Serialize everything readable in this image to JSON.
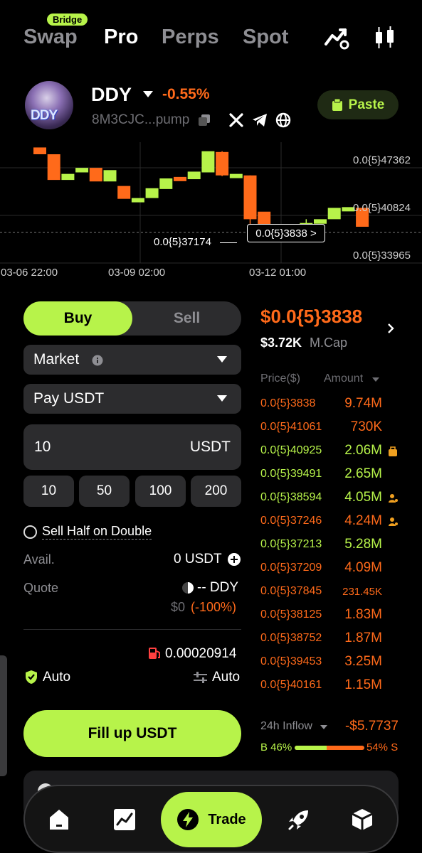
{
  "top_tabs": {
    "bridge_badge": "Bridge",
    "swap": "Swap",
    "pro": "Pro",
    "perps": "Perps",
    "spot": "Spot",
    "icons": [
      "chart-trend-icon",
      "candlestick-icon"
    ]
  },
  "token": {
    "avatar_text": "DDY",
    "name": "DDY",
    "change": "-0.55%",
    "address": "8M3CJC...pump",
    "paste_label": "Paste",
    "social_icons": [
      "copy-icon",
      "x-icon",
      "telegram-icon",
      "globe-icon"
    ]
  },
  "chart": {
    "price_labels": [
      "0.0{5}47362",
      "0.0{5}40824",
      "0.0{5}33965"
    ],
    "low_marker": "0.0{5}37174",
    "current_marker": "0.0{5}3838 >",
    "time_labels": [
      "03-06 22:00",
      "03-09 02:00",
      "03-12 01:00"
    ]
  },
  "chart_data": {
    "type": "candlestick",
    "x_ticks": [
      "03-06 22:00",
      "03-09 02:00",
      "03-12 01:00"
    ],
    "y_ticks": [
      "0.0{5}47362",
      "0.0{5}40824",
      "0.0{5}33965"
    ],
    "title": "",
    "xlabel": "",
    "ylabel": "",
    "grid": true,
    "candles": [
      {
        "open": 48.3,
        "close": 47.4,
        "dir": "down"
      },
      {
        "open": 47.4,
        "close": 44.0,
        "dir": "down"
      },
      {
        "open": 44.0,
        "close": 44.8,
        "dir": "up"
      },
      {
        "open": 45.0,
        "close": 45.6,
        "dir": "up"
      },
      {
        "open": 45.6,
        "close": 43.8,
        "dir": "down"
      },
      {
        "open": 43.8,
        "close": 45.3,
        "dir": "up"
      },
      {
        "open": 43.2,
        "close": 41.5,
        "dir": "down"
      },
      {
        "open": 41.3,
        "close": 41.6,
        "dir": "up"
      },
      {
        "open": 41.6,
        "close": 42.9,
        "dir": "up"
      },
      {
        "open": 42.8,
        "close": 44.2,
        "dir": "up"
      },
      {
        "open": 44.4,
        "close": 44.2,
        "dir": "down"
      },
      {
        "open": 44.1,
        "close": 45.1,
        "dir": "up"
      },
      {
        "open": 45.0,
        "close": 47.8,
        "dir": "up"
      },
      {
        "open": 47.7,
        "close": 44.6,
        "dir": "down",
        "high": 47.8,
        "low": 44.5
      },
      {
        "open": 44.8,
        "close": 44.5,
        "dir": "up"
      },
      {
        "open": 44.6,
        "close": 38.8,
        "dir": "down",
        "high": 44.6,
        "low": 36.9
      },
      {
        "open": 39.8,
        "close": 38.0,
        "dir": "down"
      },
      {
        "open": 37.6,
        "close": 37.3,
        "dir": "down"
      },
      {
        "open": 37.3,
        "close": 36.9,
        "dir": "up"
      },
      {
        "open": 37.0,
        "close": 38.3,
        "dir": "up",
        "high": 38.8,
        "low": 36.8
      },
      {
        "open": 38.2,
        "close": 38.8,
        "dir": "up"
      },
      {
        "open": 38.8,
        "close": 40.3,
        "dir": "up"
      },
      {
        "open": 40.3,
        "close": 40.4,
        "dir": "up"
      },
      {
        "open": 40.3,
        "close": 37.8,
        "dir": "down"
      }
    ]
  },
  "trade": {
    "buy": "Buy",
    "sell": "Sell",
    "order_type": "Market",
    "pay_token": "Pay USDT",
    "amount": "10",
    "amount_unit": "USDT",
    "presets": [
      "10",
      "50",
      "100",
      "200"
    ],
    "sell_half_label": "Sell Half on Double",
    "avail_label": "Avail.",
    "avail_value": "0 USDT",
    "quote_label": "Quote",
    "quote_value": "-- DDY",
    "quote_usd": "$0",
    "quote_pct": "(-100%)",
    "gas_value": "0.00020914",
    "auto_left": "Auto",
    "auto_right": "Auto",
    "fill_button": "Fill up USDT"
  },
  "market": {
    "price": "$0.0{5}3838",
    "mcap_value": "$3.72K",
    "mcap_label": "M.Cap",
    "col_price": "Price($)",
    "col_amount": "Amount",
    "rows": [
      {
        "price": "0.0{5}3838",
        "amount": "9.74M",
        "side": "sell",
        "icon": ""
      },
      {
        "price": "0.0{5}41061",
        "amount": "730K",
        "side": "sell",
        "icon": ""
      },
      {
        "price": "0.0{5}40925",
        "amount": "2.06M",
        "side": "buy",
        "icon": "bag-icon"
      },
      {
        "price": "0.0{5}39491",
        "amount": "2.65M",
        "side": "buy",
        "icon": ""
      },
      {
        "price": "0.0{5}38594",
        "amount": "4.05M",
        "side": "buy",
        "icon": "user-icon"
      },
      {
        "price": "0.0{5}37246",
        "amount": "4.24M",
        "side": "sell",
        "icon": "user-icon"
      },
      {
        "price": "0.0{5}37213",
        "amount": "5.28M",
        "side": "buy",
        "icon": ""
      },
      {
        "price": "0.0{5}37209",
        "amount": "4.09M",
        "side": "sell",
        "icon": ""
      },
      {
        "price": "0.0{5}37845",
        "amount": "231.45K",
        "side": "sell",
        "icon": ""
      },
      {
        "price": "0.0{5}38125",
        "amount": "1.83M",
        "side": "sell",
        "icon": ""
      },
      {
        "price": "0.0{5}38752",
        "amount": "1.87M",
        "side": "sell",
        "icon": ""
      },
      {
        "price": "0.0{5}39453",
        "amount": "3.25M",
        "side": "sell",
        "icon": ""
      },
      {
        "price": "0.0{5}40161",
        "amount": "1.15M",
        "side": "sell",
        "icon": ""
      }
    ],
    "inflow_label": "24h Inflow",
    "inflow_value": "-$5.7737",
    "buy_pct_label": "B 46%",
    "sell_pct_label": "54% S",
    "buy_fraction": 0.46
  },
  "nav": {
    "trade_label": "Trade",
    "items": [
      "home-icon",
      "market-chart-icon",
      "trade-icon",
      "rocket-icon",
      "cube-icon"
    ]
  },
  "colors": {
    "accent_green": "#b7f34a",
    "accent_orange": "#ff6a1a",
    "background": "#000000"
  }
}
